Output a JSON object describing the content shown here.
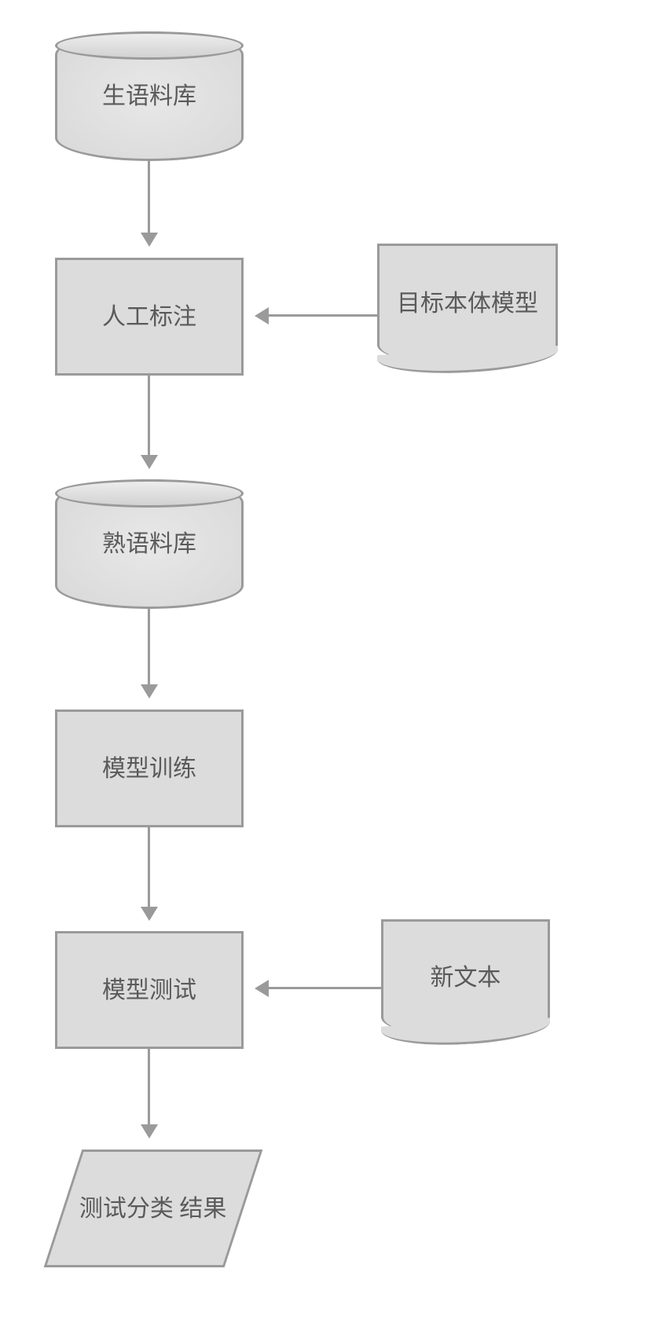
{
  "diagram": {
    "raw_corpus": "生语料库",
    "manual_annotation": "人工标注",
    "target_ontology_model": "目标本体模型",
    "processed_corpus": "熟语料库",
    "model_training": "模型训练",
    "model_testing": "模型测试",
    "new_text": "新文本",
    "test_classification_result": "测试分类\n结果"
  }
}
